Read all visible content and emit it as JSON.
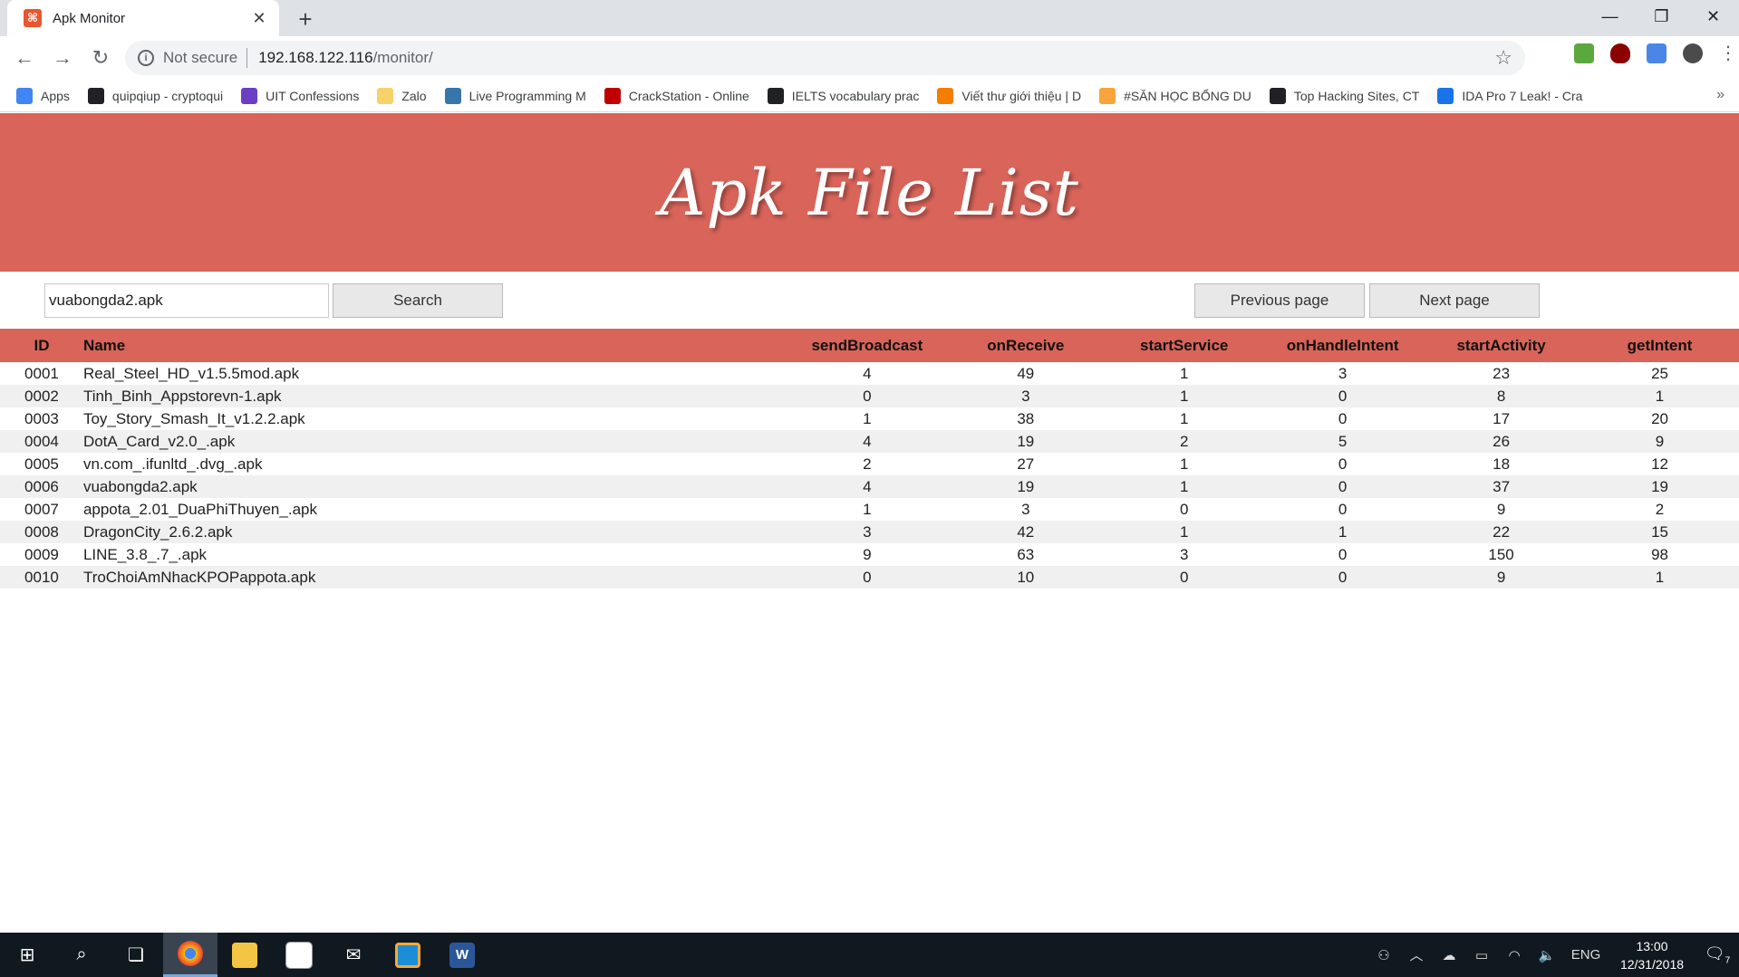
{
  "browser": {
    "tab_title": "Apk Monitor",
    "new_tab_glyph": "+",
    "security_label": "Not secure",
    "url_host": "192.168.122.116",
    "url_path": "/monitor/",
    "bookmarks": [
      {
        "label": "Apps",
        "icon": "apps-grid-icon",
        "color": "#4285f4"
      },
      {
        "label": "quipqiup - cryptoqui",
        "icon": "q-icon",
        "color": "#202124"
      },
      {
        "label": "UIT Confessions",
        "icon": "list-icon",
        "color": "#6a3fc4"
      },
      {
        "label": "Zalo",
        "icon": "folder-icon",
        "color": "#f6d26b"
      },
      {
        "label": "Live Programming M",
        "icon": "python-icon",
        "color": "#3776ab"
      },
      {
        "label": "CrackStation - Online",
        "icon": "crackstation-icon",
        "color": "#c00000"
      },
      {
        "label": "IELTS vocabulary prac",
        "icon": "g-icon",
        "color": "#202124"
      },
      {
        "label": "Viết thư giới thiệu | D",
        "icon": "blogger-icon",
        "color": "#f57d00"
      },
      {
        "label": "#SĂN HỌC BỔNG DU",
        "icon": "folder-icon",
        "color": "#f6a43b"
      },
      {
        "label": "Top Hacking Sites, CT",
        "icon": "g-icon",
        "color": "#202124"
      },
      {
        "label": "IDA Pro 7 Leak! - Cra",
        "icon": "star-badge-icon",
        "color": "#1a73e8"
      }
    ],
    "bookmarks_more": "»"
  },
  "page": {
    "banner_title": "Apk File List",
    "search": {
      "value": "vuabongda2.apk",
      "button_label": "Search"
    },
    "pagination": {
      "prev_label": "Previous page",
      "next_label": "Next page"
    },
    "table": {
      "columns": [
        "ID",
        "Name",
        "sendBroadcast",
        "onReceive",
        "startService",
        "onHandleIntent",
        "startActivity",
        "getIntent"
      ],
      "rows": [
        [
          "0001",
          "Real_Steel_HD_v1.5.5mod.apk",
          "4",
          "49",
          "1",
          "3",
          "23",
          "25"
        ],
        [
          "0002",
          "Tinh_Binh_Appstorevn-1.apk",
          "0",
          "3",
          "1",
          "0",
          "8",
          "1"
        ],
        [
          "0003",
          "Toy_Story_Smash_It_v1.2.2.apk",
          "1",
          "38",
          "1",
          "0",
          "17",
          "20"
        ],
        [
          "0004",
          "DotA_Card_v2.0_.apk",
          "4",
          "19",
          "2",
          "5",
          "26",
          "9"
        ],
        [
          "0005",
          "vn.com_.ifunltd_.dvg_.apk",
          "2",
          "27",
          "1",
          "0",
          "18",
          "12"
        ],
        [
          "0006",
          "vuabongda2.apk",
          "4",
          "19",
          "1",
          "0",
          "37",
          "19"
        ],
        [
          "0007",
          "appota_2.01_DuaPhiThuyen_.apk",
          "1",
          "3",
          "0",
          "0",
          "9",
          "2"
        ],
        [
          "0008",
          "DragonCity_2.6.2.apk",
          "3",
          "42",
          "1",
          "1",
          "22",
          "15"
        ],
        [
          "0009",
          "LINE_3.8_.7_.apk",
          "9",
          "63",
          "3",
          "0",
          "150",
          "98"
        ],
        [
          "0010",
          "TroChoiAmNhacKPOPappota.apk",
          "0",
          "10",
          "0",
          "0",
          "9",
          "1"
        ]
      ]
    }
  },
  "taskbar": {
    "language": "ENG",
    "time": "13:00",
    "date": "12/31/2018",
    "notification_count": "7"
  },
  "colors": {
    "accent": "#d9645a",
    "taskbar": "#101820"
  }
}
